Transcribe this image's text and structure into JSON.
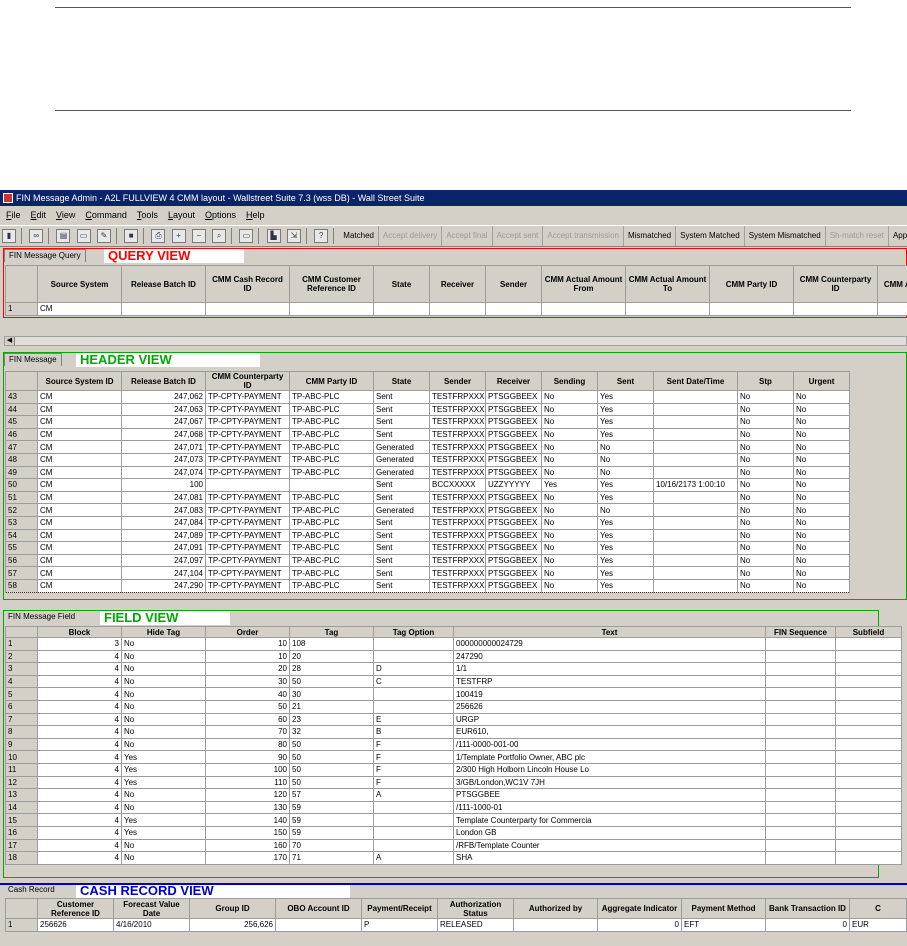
{
  "window": {
    "title": "FIN Message Admin - A2L FULLVIEW 4 CMM layout - Wallstreet Suite 7.3 (wss DB) - Wall Street Suite"
  },
  "menu": [
    "File",
    "Edit",
    "View",
    "Command",
    "Tools",
    "Layout",
    "Options",
    "Help"
  ],
  "toolbar": {
    "buttons": [
      {
        "label": "Matched",
        "enabled": true
      },
      {
        "label": "Accept delivery",
        "enabled": false
      },
      {
        "label": "Accept final",
        "enabled": false
      },
      {
        "label": "Accept sent",
        "enabled": false
      },
      {
        "label": "Accept transmission",
        "enabled": false
      },
      {
        "label": "Mismatched",
        "enabled": true
      },
      {
        "label": "System Matched",
        "enabled": true
      },
      {
        "label": "System Mismatched",
        "enabled": true
      },
      {
        "label": "Sh-match reset",
        "enabled": false
      },
      {
        "label": "Apply",
        "enabled": true
      }
    ]
  },
  "query": {
    "tab": "FIN Message Query",
    "label": "QUERY VIEW",
    "color": "#ff0000",
    "columns": [
      "",
      "Source System",
      "Release Batch ID",
      "CMM Cash Record ID",
      "CMM Customer Reference ID",
      "State",
      "Receiver",
      "Sender",
      "CMM Actual Amount From",
      "CMM Actual Amount To",
      "CMM Party ID",
      "CMM Counterparty ID",
      "CMM Ac"
    ],
    "rows": [
      [
        "1",
        "CM",
        "",
        "",
        "",
        "",
        "",
        "",
        "",
        "",
        "",
        "",
        ""
      ]
    ]
  },
  "header": {
    "tab": "FIN Message",
    "label": "HEADER VIEW",
    "color": "#00aa00",
    "columns": [
      "",
      "Source System ID",
      "Release Batch ID",
      "CMM Counterparty ID",
      "CMM Party ID",
      "State",
      "Sender",
      "Receiver",
      "Sending",
      "Sent",
      "Sent Date/Time",
      "Stp",
      "Urgent"
    ],
    "rows": [
      [
        "43",
        "CM",
        "247,062",
        "TP-CPTY-PAYMENT",
        "TP-ABC-PLC",
        "Sent",
        "TESTFRPXXX",
        "PTSGGBEEX",
        "No",
        "Yes",
        "",
        "No",
        "No"
      ],
      [
        "44",
        "CM",
        "247,063",
        "TP-CPTY-PAYMENT",
        "TP-ABC-PLC",
        "Sent",
        "TESTFRPXXX",
        "PTSGGBEEX",
        "No",
        "Yes",
        "",
        "No",
        "No"
      ],
      [
        "45",
        "CM",
        "247,067",
        "TP-CPTY-PAYMENT",
        "TP-ABC-PLC",
        "Sent",
        "TESTFRPXXX",
        "PTSGGBEEX",
        "No",
        "Yes",
        "",
        "No",
        "No"
      ],
      [
        "46",
        "CM",
        "247,068",
        "TP-CPTY-PAYMENT",
        "TP-ABC-PLC",
        "Sent",
        "TESTFRPXXX",
        "PTSGGBEEX",
        "No",
        "Yes",
        "",
        "No",
        "No"
      ],
      [
        "47",
        "CM",
        "247,071",
        "TP-CPTY-PAYMENT",
        "TP-ABC-PLC",
        "Generated",
        "TESTFRPXXX",
        "PTSGGBEEX",
        "No",
        "No",
        "",
        "No",
        "No"
      ],
      [
        "48",
        "CM",
        "247,073",
        "TP-CPTY-PAYMENT",
        "TP-ABC-PLC",
        "Generated",
        "TESTFRPXXX",
        "PTSGGBEEX",
        "No",
        "No",
        "",
        "No",
        "No"
      ],
      [
        "49",
        "CM",
        "247,074",
        "TP-CPTY-PAYMENT",
        "TP-ABC-PLC",
        "Generated",
        "TESTFRPXXX",
        "PTSGGBEEX",
        "No",
        "No",
        "",
        "No",
        "No"
      ],
      [
        "50",
        "CM",
        "100",
        "",
        "",
        "Sent",
        "BCCXXXXX",
        "UZZYYYYY",
        "Yes",
        "Yes",
        "10/16/2173 1:00:10",
        "No",
        "No"
      ],
      [
        "51",
        "CM",
        "247,081",
        "TP-CPTY-PAYMENT",
        "TP-ABC-PLC",
        "Sent",
        "TESTFRPXXX",
        "PTSGGBEEX",
        "No",
        "Yes",
        "",
        "No",
        "No"
      ],
      [
        "52",
        "CM",
        "247,083",
        "TP-CPTY-PAYMENT",
        "TP-ABC-PLC",
        "Generated",
        "TESTFRPXXX",
        "PTSGGBEEX",
        "No",
        "No",
        "",
        "No",
        "No"
      ],
      [
        "53",
        "CM",
        "247,084",
        "TP-CPTY-PAYMENT",
        "TP-ABC-PLC",
        "Sent",
        "TESTFRPXXX",
        "PTSGGBEEX",
        "No",
        "Yes",
        "",
        "No",
        "No"
      ],
      [
        "54",
        "CM",
        "247,089",
        "TP-CPTY-PAYMENT",
        "TP-ABC-PLC",
        "Sent",
        "TESTFRPXXX",
        "PTSGGBEEX",
        "No",
        "Yes",
        "",
        "No",
        "No"
      ],
      [
        "55",
        "CM",
        "247,091",
        "TP-CPTY-PAYMENT",
        "TP-ABC-PLC",
        "Sent",
        "TESTFRPXXX",
        "PTSGGBEEX",
        "No",
        "Yes",
        "",
        "No",
        "No"
      ],
      [
        "56",
        "CM",
        "247,097",
        "TP-CPTY-PAYMENT",
        "TP-ABC-PLC",
        "Sent",
        "TESTFRPXXX",
        "PTSGGBEEX",
        "No",
        "Yes",
        "",
        "No",
        "No"
      ],
      [
        "57",
        "CM",
        "247,104",
        "TP-CPTY-PAYMENT",
        "TP-ABC-PLC",
        "Sent",
        "TESTFRPXXX",
        "PTSGGBEEX",
        "No",
        "Yes",
        "",
        "No",
        "No"
      ],
      [
        "58",
        "CM",
        "247,290",
        "TP-CPTY-PAYMENT",
        "TP-ABC-PLC",
        "Sent",
        "TESTFRPXXX",
        "PTSGGBEEX",
        "No",
        "Yes",
        "",
        "No",
        "No"
      ]
    ]
  },
  "field": {
    "tab": "FIN Message Field",
    "label": "FIELD VIEW",
    "color": "#00aa00",
    "columns": [
      "",
      "Block",
      "Hide Tag",
      "Order",
      "Tag",
      "Tag Option",
      "Text",
      "FIN Sequence",
      "Subfield"
    ],
    "rows": [
      [
        "1",
        "3",
        "No",
        "10",
        "108",
        "",
        "000000000024729",
        "",
        ""
      ],
      [
        "2",
        "4",
        "No",
        "10",
        "20",
        "",
        "247290",
        "",
        ""
      ],
      [
        "3",
        "4",
        "No",
        "20",
        "28",
        "D",
        "1/1",
        "",
        ""
      ],
      [
        "4",
        "4",
        "No",
        "30",
        "50",
        "C",
        "TESTFRP",
        "",
        ""
      ],
      [
        "5",
        "4",
        "No",
        "40",
        "30",
        "",
        "100419",
        "",
        ""
      ],
      [
        "6",
        "4",
        "No",
        "50",
        "21",
        "",
        "256626",
        "",
        ""
      ],
      [
        "7",
        "4",
        "No",
        "60",
        "23",
        "E",
        "URGP",
        "",
        ""
      ],
      [
        "8",
        "4",
        "No",
        "70",
        "32",
        "B",
        "EUR610,",
        "",
        ""
      ],
      [
        "9",
        "4",
        "No",
        "80",
        "50",
        "F",
        "/111-0000-001-00",
        "",
        ""
      ],
      [
        "10",
        "4",
        "Yes",
        "90",
        "50",
        "F",
        "1/Template Portfolio Owner, ABC plc",
        "",
        ""
      ],
      [
        "11",
        "4",
        "Yes",
        "100",
        "50",
        "F",
        "2/300 High Holborn Lincoln House Lo",
        "",
        ""
      ],
      [
        "12",
        "4",
        "Yes",
        "110",
        "50",
        "F",
        "3/GB/London,WC1V 7JH",
        "",
        ""
      ],
      [
        "13",
        "4",
        "No",
        "120",
        "57",
        "A",
        "PTSGGBEE",
        "",
        ""
      ],
      [
        "14",
        "4",
        "No",
        "130",
        "59",
        "",
        "/111-1000-01",
        "",
        ""
      ],
      [
        "15",
        "4",
        "Yes",
        "140",
        "59",
        "",
        "Template Counterparty for Commercia",
        "",
        ""
      ],
      [
        "16",
        "4",
        "Yes",
        "150",
        "59",
        "",
        "London GB",
        "",
        ""
      ],
      [
        "17",
        "4",
        "No",
        "160",
        "70",
        "",
        "/RFB/Template Counter",
        "",
        ""
      ],
      [
        "18",
        "4",
        "No",
        "170",
        "71",
        "A",
        "SHA",
        "",
        ""
      ]
    ]
  },
  "cash": {
    "tab": "Cash Record",
    "label": "CASH RECORD VIEW",
    "color": "#0000cc",
    "columns": [
      "",
      "Customer Reference ID",
      "Forecast Value Date",
      "Group ID",
      "OBO Account ID",
      "Payment/Receipt",
      "Authorization Status",
      "Authorized by",
      "Aggregate Indicator",
      "Payment Method",
      "Bank Transaction ID",
      "C"
    ],
    "rows": [
      [
        "1",
        "256626",
        "4/16/2010",
        "256,626",
        "",
        "P",
        "RELEASED",
        "",
        "0",
        "EFT",
        "0",
        "EUR"
      ]
    ]
  }
}
